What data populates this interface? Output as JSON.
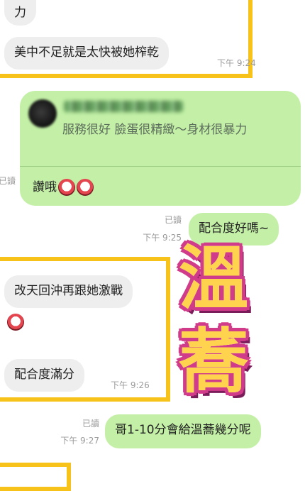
{
  "chat": {
    "msg1_partial": "力",
    "msg2": "美中不足就是太快被她榨乾",
    "msg2_time": "下午 9:24",
    "reply_quote": "服務很好 臉蛋很精緻～身材很暴力",
    "reply_text": "讚哦",
    "reply_emoji": "devil-face-emoji",
    "out1_read": "已讀",
    "out1_time": "下午 9:25",
    "out1": "配合度好嗎~",
    "in3": "改天回沖再跟她激戰",
    "in3_emoji": "devil-face-emoji",
    "in4": "配合度滿分",
    "in4_time": "下午 9:26",
    "out2_read": "已讀",
    "out2_time": "下午 9:27",
    "out2": "哥1-10分會給溫蕎幾分呢",
    "side_read": "已讀"
  },
  "sticker": {
    "char1": "溫",
    "char2": "蕎"
  },
  "colors": {
    "highlight_frame": "#f7c31a",
    "outgoing_bubble": "#c3f0a6",
    "incoming_bubble": "#eeeeee"
  }
}
